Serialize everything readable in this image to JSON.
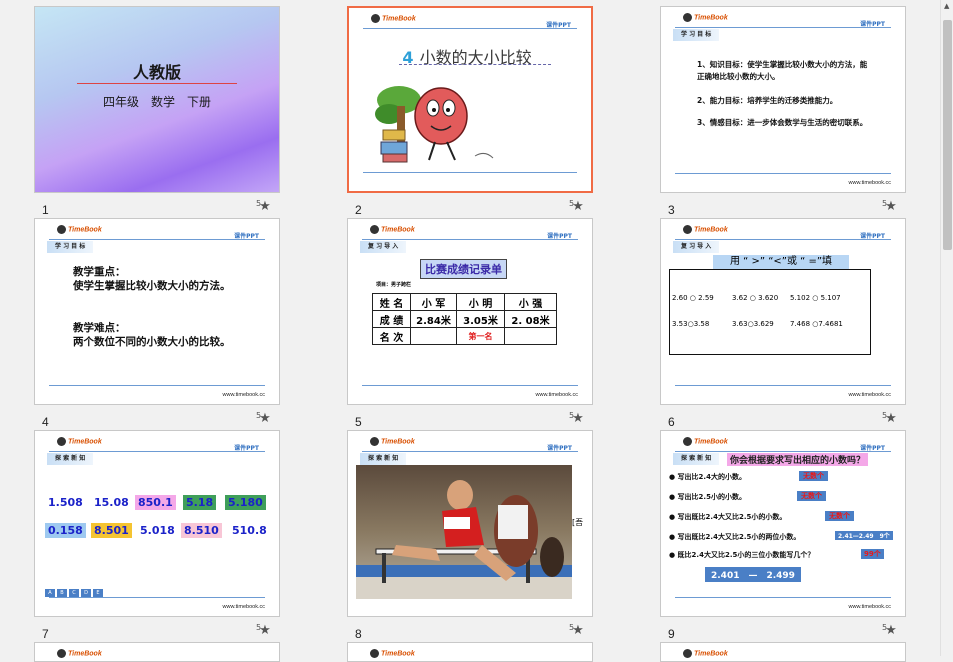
{
  "slides": [
    {
      "num": "1",
      "title": "人教版",
      "subtitle": "四年级　数学　下册"
    },
    {
      "num": "2",
      "logo": "TimeBook",
      "kj": "课件PPT",
      "title_num": "4",
      "title": "小数的大小比较"
    },
    {
      "num": "3",
      "logo": "TimeBook",
      "kj": "课件PPT",
      "tag": "学 习 目 标",
      "items": [
        "1、知识目标：使学生掌握比较小数大小的方法，能正确地比较小数的大小。",
        "2、能力目标：培养学生的迁移类推能力。",
        "3、情感目标：进一步体会数学与生活的密切联系。"
      ],
      "www": "www.timebook.cc"
    },
    {
      "num": "4",
      "logo": "TimeBook",
      "kj": "课件PPT",
      "tag": "学 习 目 标",
      "lines": [
        "教学重点：",
        "使学生掌握比较小数大小的方法。",
        "教学难点：",
        "两个数位不同的小数大小的比较。"
      ],
      "www": "www.timebook.cc"
    },
    {
      "num": "5",
      "logo": "TimeBook",
      "kj": "课件PPT",
      "tag": "复 习 导 入",
      "table_title": "比赛成绩记录单",
      "project": "项目：男子跨栏",
      "rows": [
        [
          "姓 名",
          "小 军",
          "小 明",
          "小 强"
        ],
        [
          "成 绩",
          "2.84米",
          "3.05米",
          "2. 08米"
        ],
        [
          "名 次",
          "",
          "第一名",
          ""
        ]
      ],
      "www": "www.timebook.cc"
    },
    {
      "num": "6",
      "logo": "TimeBook",
      "kj": "课件PPT",
      "tag": "复 习 导 入",
      "prompt": "用 “ >” “<”或 “ =”填",
      "pairs": [
        "2.60 ○ 2.59",
        "3.62 ○ 3.620",
        "5.102 ○ 5.107",
        "3.53○3.58",
        "3.63○3.629",
        "7.468 ○7.4681"
      ],
      "www": "www.timebook.cc"
    },
    {
      "num": "7",
      "logo": "TimeBook",
      "kj": "课件PPT",
      "tag": "探 索 新 知",
      "numbers": [
        "1.508",
        "15.08",
        "850.1",
        "5.18",
        "5.180",
        "0.158",
        "8.501",
        "5.018",
        "8.510",
        "510.8"
      ],
      "letters": [
        "A",
        "B",
        "C",
        "D",
        "E"
      ],
      "www": "www.timebook.cc"
    },
    {
      "num": "8",
      "logo": "TimeBook",
      "kj": "课件PPT",
      "tag": "探 索 新 知",
      "side": "[吾"
    },
    {
      "num": "9",
      "logo": "TimeBook",
      "kj": "课件PPT",
      "tag": "探 索 新 知",
      "question": "你会根据要求写出相应的小数吗？",
      "rows": [
        {
          "q": "写出比2.4大的小数。",
          "a": "无数个"
        },
        {
          "q": "写出比2.5小的小数。",
          "a": "无数个"
        },
        {
          "q": "写出既比2.4大又比2.5小的小数。",
          "a": "无数个"
        },
        {
          "q": "写出既比2.4大又比2.5小的两位小数。",
          "a": "2.41—2.49　9个"
        },
        {
          "q": "既比2.4大又比2.5小的三位小数能写几个？",
          "a": "99个"
        }
      ],
      "range": "2.401　—　2.499",
      "www": "www.timebook.cc"
    }
  ],
  "colors": {
    "selected_border": "#f06b45",
    "accent_blue": "#2ea0d8"
  },
  "icons": {
    "star": "star-icon"
  }
}
